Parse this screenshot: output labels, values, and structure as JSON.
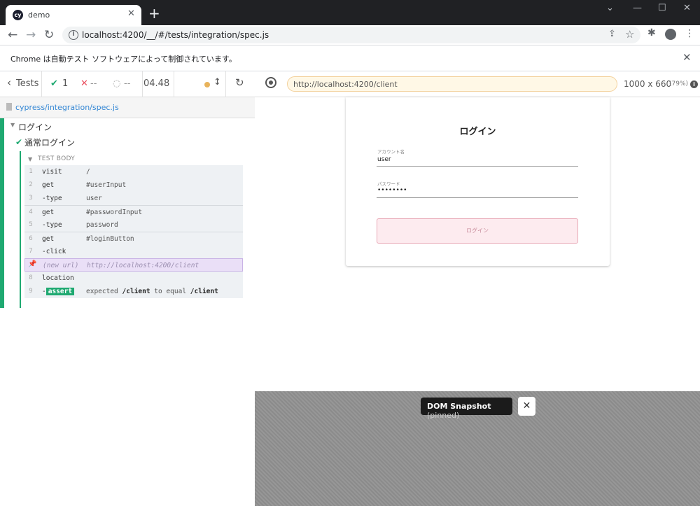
{
  "browser": {
    "tab_title": "demo",
    "tab_favicon_text": "cy",
    "address": "localhost:4200/__/#/tests/integration/spec.js",
    "infobar_text": "Chrome は自動テスト ソフトウェアによって制御されています。",
    "icons": [
      "back-icon",
      "forward-icon",
      "reload-icon",
      "info-icon",
      "share-icon",
      "star-icon",
      "extensions-icon",
      "profile-icon",
      "menu-icon",
      "close-icon"
    ]
  },
  "reporter": {
    "tests_label": "Tests",
    "passed": "1",
    "failed": "--",
    "pending": "--",
    "duration": "04.48",
    "spec_path": "cypress/integration/spec.js",
    "suite": "ログイン",
    "test": "通常ログイン",
    "test_body_label": "TEST BODY",
    "commands": [
      {
        "num": "1",
        "name": "visit",
        "message": "/"
      },
      {
        "num": "2",
        "name": "get",
        "message": "#userInput"
      },
      {
        "num": "3",
        "name": " -type",
        "message": "user"
      },
      {
        "num": "4",
        "name": "get",
        "message": "#passwordInput"
      },
      {
        "num": "5",
        "name": " -type",
        "message": "password"
      },
      {
        "num": "6",
        "name": "get",
        "message": "#loginButton"
      },
      {
        "num": "7",
        "name": " -click",
        "message": ""
      },
      {
        "num": "",
        "name": "(new url)",
        "message": "http://localhost:4200/client"
      },
      {
        "num": "8",
        "name": "location",
        "message": ""
      },
      {
        "num": "9",
        "name": " -",
        "badge": "assert",
        "message_parts": [
          "expected",
          "/client",
          "to equal",
          "/client"
        ]
      }
    ],
    "colors": {
      "pass": "#1fa971",
      "link": "#3386d4",
      "pinned": "#eadff7"
    }
  },
  "aut": {
    "url": "http://localhost:4200/client",
    "viewport_size": "1000 x 660",
    "viewport_scale": "(79%)",
    "login": {
      "heading": "ログイン",
      "account_label": "アカウント名",
      "account_value": "user",
      "password_label": "パスワード",
      "password_value": "••••••••",
      "button_label": "ログイン"
    },
    "snapshot_label": "DOM Snapshot",
    "snapshot_state": "(pinned)"
  }
}
